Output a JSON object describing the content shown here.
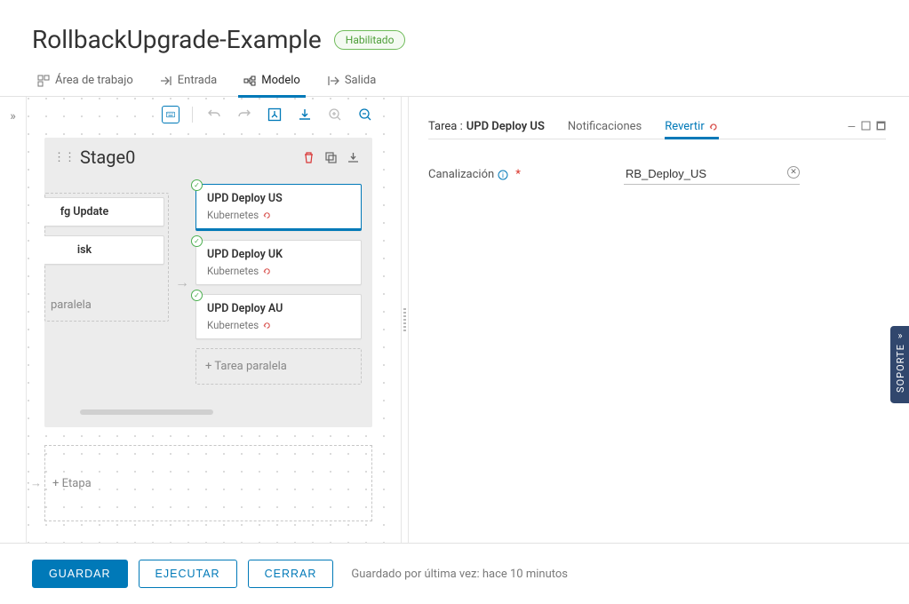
{
  "header": {
    "title": "RollbackUpgrade-Example",
    "status": "Habilitado"
  },
  "tabs": [
    {
      "label": "Área de trabajo"
    },
    {
      "label": "Entrada"
    },
    {
      "label": "Modelo"
    },
    {
      "label": "Salida"
    }
  ],
  "stage": {
    "name": "Stage0",
    "left_tasks": [
      {
        "name": "fg Update"
      },
      {
        "name": "isk"
      }
    ],
    "left_placeholder": "paralela",
    "tasks": [
      {
        "name": "UPD Deploy US",
        "type": "Kubernetes",
        "selected": true
      },
      {
        "name": "UPD Deploy UK",
        "type": "Kubernetes",
        "selected": false
      },
      {
        "name": "UPD Deploy AU",
        "type": "Kubernetes",
        "selected": false
      }
    ],
    "parallel_label": "Tarea paralela"
  },
  "add_stage_label": "Etapa",
  "right_panel": {
    "task_prefix": "Tarea :",
    "task_name": "UPD Deploy US",
    "tabs": {
      "notif": "Notificaciones",
      "revert": "Revertir"
    },
    "form": {
      "label": "Canalización",
      "value": "RB_Deploy_US"
    }
  },
  "support_label": "SOPORTE",
  "footer": {
    "save": "GUARDAR",
    "run": "EJECUTAR",
    "close": "CERRAR",
    "saved": "Guardado por última vez: hace 10 minutos"
  }
}
